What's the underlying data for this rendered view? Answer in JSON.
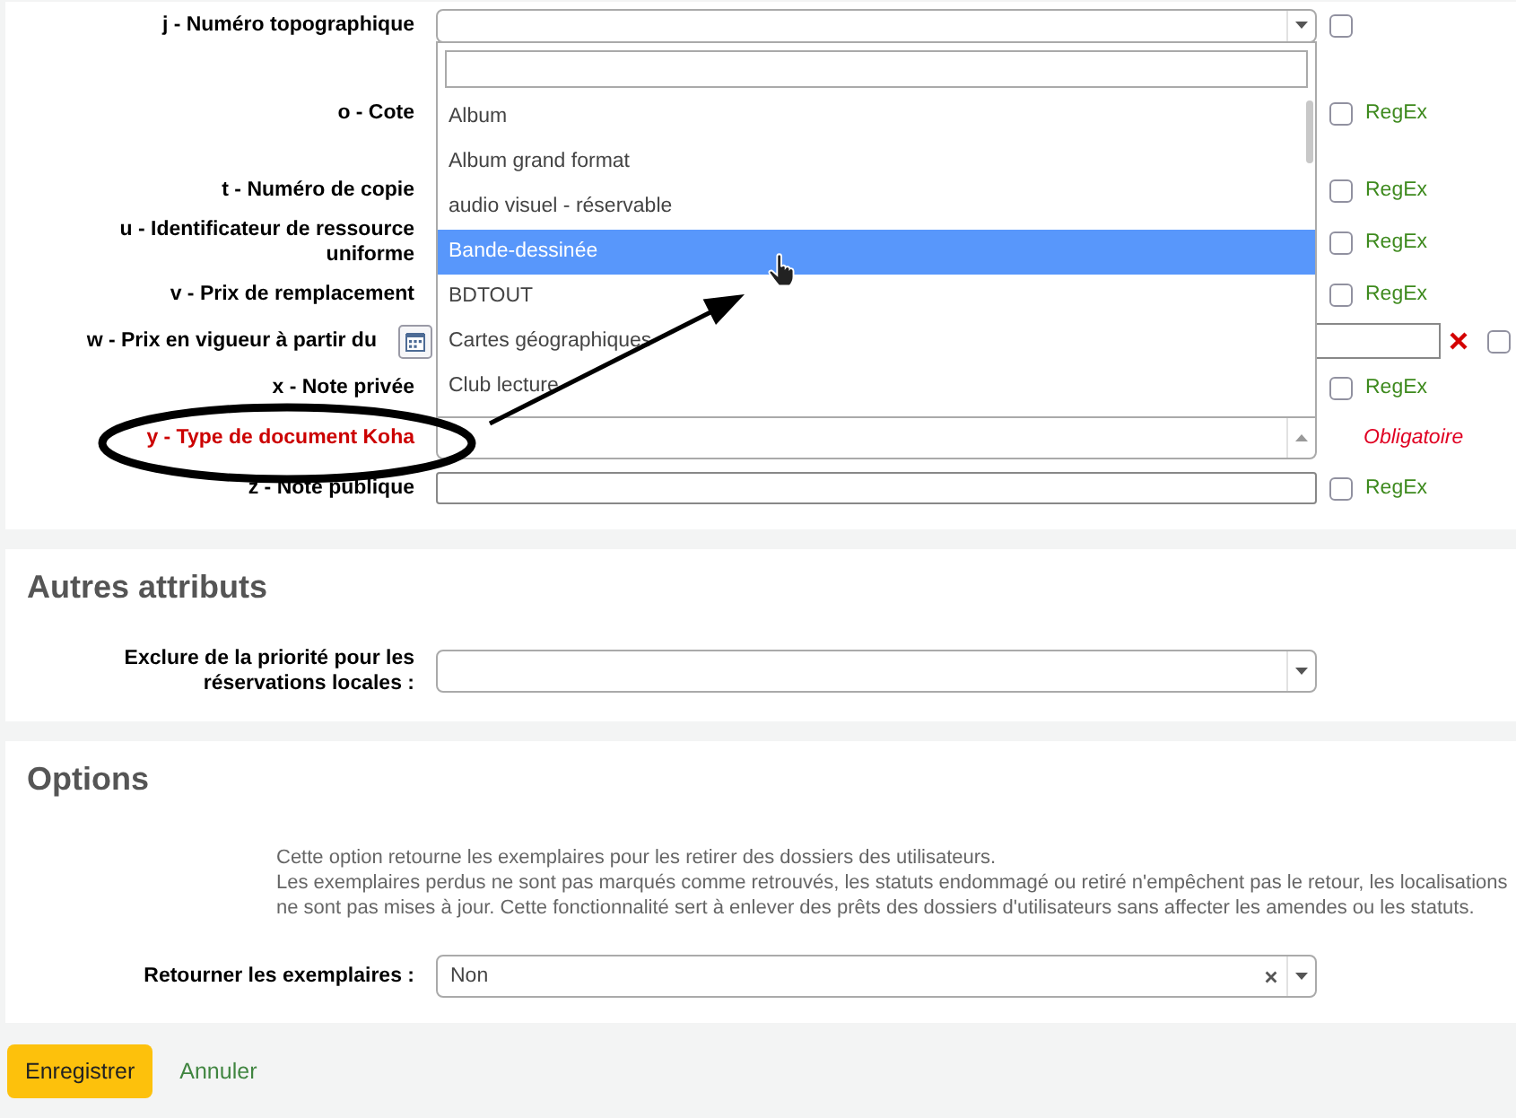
{
  "subfields": [
    {
      "label": "j - Numéro topographique",
      "required": false,
      "field": {
        "kind": "select",
        "expanded": false
      },
      "checkbox": {
        "checked": false
      }
    },
    {
      "label": "o - Cote",
      "required": false,
      "checkbox": {
        "checked": false
      },
      "regex": "RegEx"
    },
    {
      "label": "t - Numéro de copie",
      "required": false,
      "checkbox": {
        "checked": false
      },
      "regex": "RegEx"
    },
    {
      "label": "u - Identificateur de ressource uniforme",
      "required": false,
      "checkbox": {
        "checked": false
      },
      "regex": "RegEx"
    },
    {
      "label": "v - Prix de remplacement",
      "required": false,
      "checkbox": {
        "checked": false
      },
      "regex": "RegEx"
    },
    {
      "label": "w - Prix en vigueur à partir du",
      "required": false,
      "field": {
        "kind": "date"
      },
      "checkbox": {
        "checked": false
      }
    },
    {
      "label": "x - Note privée",
      "required": false,
      "checkbox": {
        "checked": false
      },
      "regex": "RegEx"
    },
    {
      "label": "y - Type de document Koha",
      "required": true,
      "field": {
        "kind": "select",
        "expanded": true,
        "options": [
          {
            "label": "Album",
            "selected": false
          },
          {
            "label": "Album grand format",
            "selected": false
          },
          {
            "label": "audio visuel - réservable",
            "selected": false
          },
          {
            "label": "Bande-dessinée",
            "selected": true
          },
          {
            "label": "BDTOUT",
            "selected": false
          },
          {
            "label": "Cartes géographiques",
            "selected": false
          },
          {
            "label": "Club lecture",
            "selected": false
          }
        ]
      },
      "required_note": "Obligatoire"
    },
    {
      "label": "z - Note publique",
      "required": false,
      "field": {
        "kind": "text"
      },
      "checkbox": {
        "checked": false
      },
      "regex": "RegEx"
    }
  ],
  "sections": [
    {
      "title": "Autres attributs",
      "rows": [
        {
          "label": "Exclure de la priorité pour les réservations locales :",
          "field": {
            "kind": "select",
            "expanded": false
          }
        }
      ]
    },
    {
      "title": "Options",
      "description": [
        "Cette option retourne les exemplaires pour les retirer des dossiers des utilisateurs.",
        "Les exemplaires perdus ne sont pas marqués comme retrouvés, les statuts endommagé ou retiré n'empêchent pas le retour, les localisations",
        "ne sont pas mises à jour. Cette fonctionnalité sert à enlever des prêts des dossiers d'utilisateurs sans affecter les amendes ou les statuts."
      ],
      "rows": [
        {
          "label": "Retourner les exemplaires :",
          "field": {
            "kind": "select",
            "expanded": false,
            "value": "Non"
          }
        }
      ]
    }
  ],
  "buttons": [
    {
      "label": "Enregistrer",
      "kind": "primary"
    },
    {
      "label": "Annuler",
      "kind": "link"
    }
  ]
}
